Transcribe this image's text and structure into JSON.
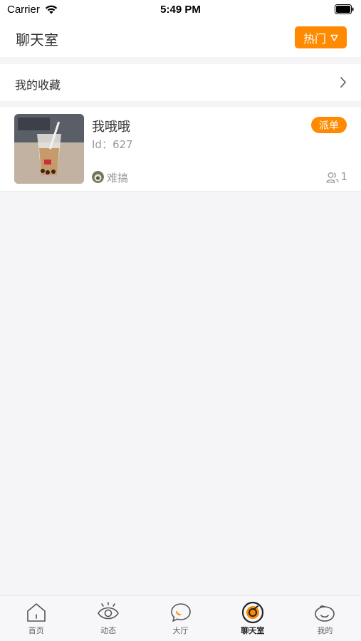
{
  "status_bar": {
    "carrier": "Carrier",
    "time": "5:49 PM"
  },
  "header": {
    "title": "聊天室",
    "hot_button_label": "热门"
  },
  "favorites": {
    "label": "我的收藏"
  },
  "rooms": [
    {
      "name": "我哦哦",
      "id_text": "Id：627",
      "badge": "派单",
      "owner": "难搞",
      "member_count": "1"
    }
  ],
  "tab_bar": {
    "items": [
      {
        "label": "首页",
        "icon": "home-icon",
        "active": false
      },
      {
        "label": "动态",
        "icon": "eye-icon",
        "active": false
      },
      {
        "label": "大厅",
        "icon": "chat-bubble-icon",
        "active": false
      },
      {
        "label": "聊天室",
        "icon": "chatroom-icon",
        "active": true
      },
      {
        "label": "我的",
        "icon": "smiley-face-icon",
        "active": false
      }
    ]
  },
  "colors": {
    "accent": "#ff8a00",
    "background": "#f5f5f7",
    "secondary_text": "#999999"
  }
}
